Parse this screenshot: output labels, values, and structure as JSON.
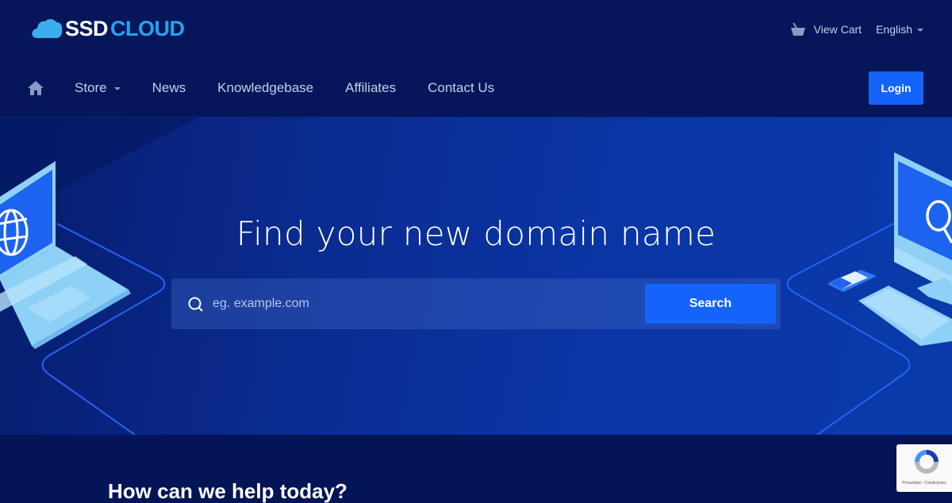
{
  "header": {
    "logo": {
      "part1": "SSD",
      "part2": "CLOUD",
      "icon": "cloud-icon"
    },
    "view_cart": {
      "label": "View Cart",
      "icon": "basket-icon"
    },
    "language": {
      "label": "English",
      "icon": "chevron-down-icon"
    }
  },
  "nav": {
    "home_icon": "home-icon",
    "items": [
      {
        "label": "Store",
        "has_dropdown": true
      },
      {
        "label": "News",
        "has_dropdown": false
      },
      {
        "label": "Knowledgebase",
        "has_dropdown": false
      },
      {
        "label": "Affiliates",
        "has_dropdown": false
      },
      {
        "label": "Contact Us",
        "has_dropdown": false
      }
    ],
    "login_label": "Login"
  },
  "hero": {
    "title": "Find your new domain name",
    "search": {
      "placeholder": "eg. example.com",
      "value": "",
      "button_label": "Search",
      "icon": "search-icon"
    }
  },
  "section": {
    "heading": "How can we help today?"
  },
  "recaptcha": {
    "text": "Privacidad - Condiciones"
  },
  "colors": {
    "header_bg": "#05165a",
    "accent": "#1464fb",
    "logo_cloud": "#23a4ee",
    "nav_text": "#c6cdea"
  }
}
